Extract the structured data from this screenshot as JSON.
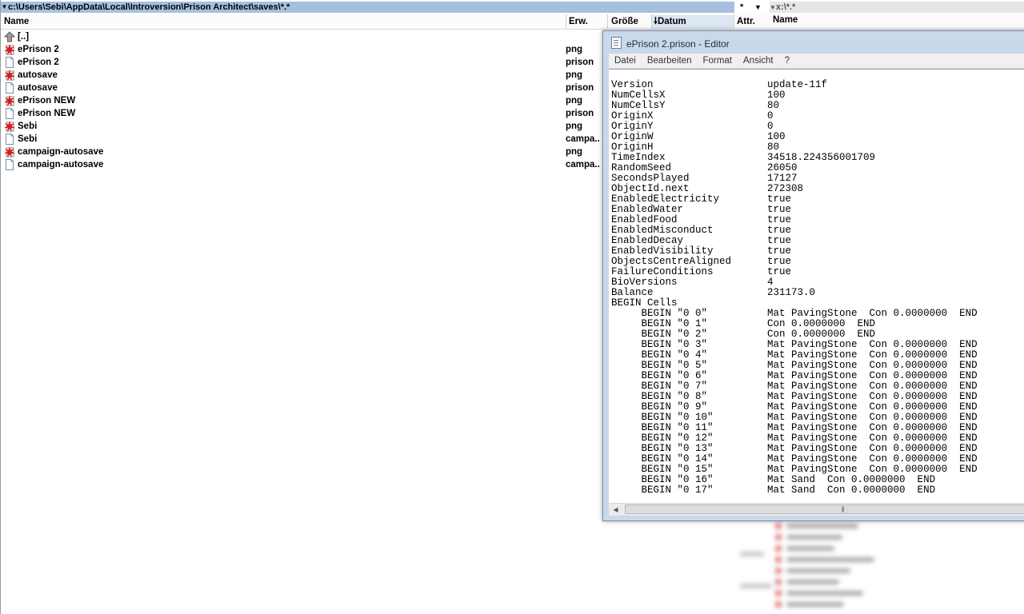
{
  "left_panel": {
    "path": "c:\\Users\\Sebi\\AppData\\Local\\Introversion\\Prison Architect\\saves\\*.*",
    "filter": "*",
    "columns": {
      "name": "Name",
      "ext": "Erw.",
      "size": "Größe",
      "date": "Datum",
      "attr": "Attr."
    },
    "files": [
      {
        "name": "[..]",
        "ext": "",
        "icon": "up-icon"
      },
      {
        "name": "ePrison 2",
        "ext": "png",
        "icon": "image-icon"
      },
      {
        "name": "ePrison 2",
        "ext": "prison",
        "icon": "file-icon"
      },
      {
        "name": "autosave",
        "ext": "png",
        "icon": "image-icon"
      },
      {
        "name": "autosave",
        "ext": "prison",
        "icon": "file-icon"
      },
      {
        "name": "ePrison NEW",
        "ext": "png",
        "icon": "image-icon"
      },
      {
        "name": "ePrison NEW",
        "ext": "prison",
        "icon": "file-icon"
      },
      {
        "name": "Sebi",
        "ext": "png",
        "icon": "image-icon"
      },
      {
        "name": "Sebi",
        "ext": "campa..",
        "icon": "file-icon"
      },
      {
        "name": "campaign-autosave",
        "ext": "png",
        "icon": "image-icon"
      },
      {
        "name": "campaign-autosave",
        "ext": "campa..",
        "icon": "file-icon"
      }
    ]
  },
  "right_panel": {
    "path": "x:\\*.*",
    "column_name": "Name"
  },
  "editor": {
    "title": "ePrison 2.prison - Editor",
    "menu": [
      "Datei",
      "Bearbeiten",
      "Format",
      "Ansicht",
      "?"
    ],
    "lines": [
      "Version                   update-11f",
      "NumCellsX                 100",
      "NumCellsY                 80",
      "OriginX                   0",
      "OriginY                   0",
      "OriginW                   100",
      "OriginH                   80",
      "TimeIndex                 34518.224356001709",
      "RandomSeed                26050",
      "SecondsPlayed             17127",
      "ObjectId.next             272308",
      "EnabledElectricity        true",
      "EnabledWater              true",
      "EnabledFood               true",
      "EnabledMisconduct         true",
      "EnabledDecay              true",
      "EnabledVisibility         true",
      "ObjectsCentreAligned      true",
      "FailureConditions         true",
      "BioVersions               4",
      "Balance                   231173.0",
      "BEGIN Cells",
      "     BEGIN \"0 0\"          Mat PavingStone  Con 0.0000000  END",
      "     BEGIN \"0 1\"          Con 0.0000000  END",
      "     BEGIN \"0 2\"          Con 0.0000000  END",
      "     BEGIN \"0 3\"          Mat PavingStone  Con 0.0000000  END",
      "     BEGIN \"0 4\"          Mat PavingStone  Con 0.0000000  END",
      "     BEGIN \"0 5\"          Mat PavingStone  Con 0.0000000  END",
      "     BEGIN \"0 6\"          Mat PavingStone  Con 0.0000000  END",
      "     BEGIN \"0 7\"          Mat PavingStone  Con 0.0000000  END",
      "     BEGIN \"0 8\"          Mat PavingStone  Con 0.0000000  END",
      "     BEGIN \"0 9\"          Mat PavingStone  Con 0.0000000  END",
      "     BEGIN \"0 10\"         Mat PavingStone  Con 0.0000000  END",
      "     BEGIN \"0 11\"         Mat PavingStone  Con 0.0000000  END",
      "     BEGIN \"0 12\"         Mat PavingStone  Con 0.0000000  END",
      "     BEGIN \"0 13\"         Mat PavingStone  Con 0.0000000  END",
      "     BEGIN \"0 14\"         Mat PavingStone  Con 0.0000000  END",
      "     BEGIN \"0 15\"         Mat PavingStone  Con 0.0000000  END",
      "     BEGIN \"0 16\"         Mat Sand  Con 0.0000000  END",
      "     BEGIN \"0 17\"         Mat Sand  Con 0.0000000  END"
    ]
  },
  "colors": {
    "path_active": "#a7c0df",
    "sort_column": "#dde7f3",
    "editor_frame": "#c9d8eb",
    "image_icon_red": "#d21f1f"
  }
}
